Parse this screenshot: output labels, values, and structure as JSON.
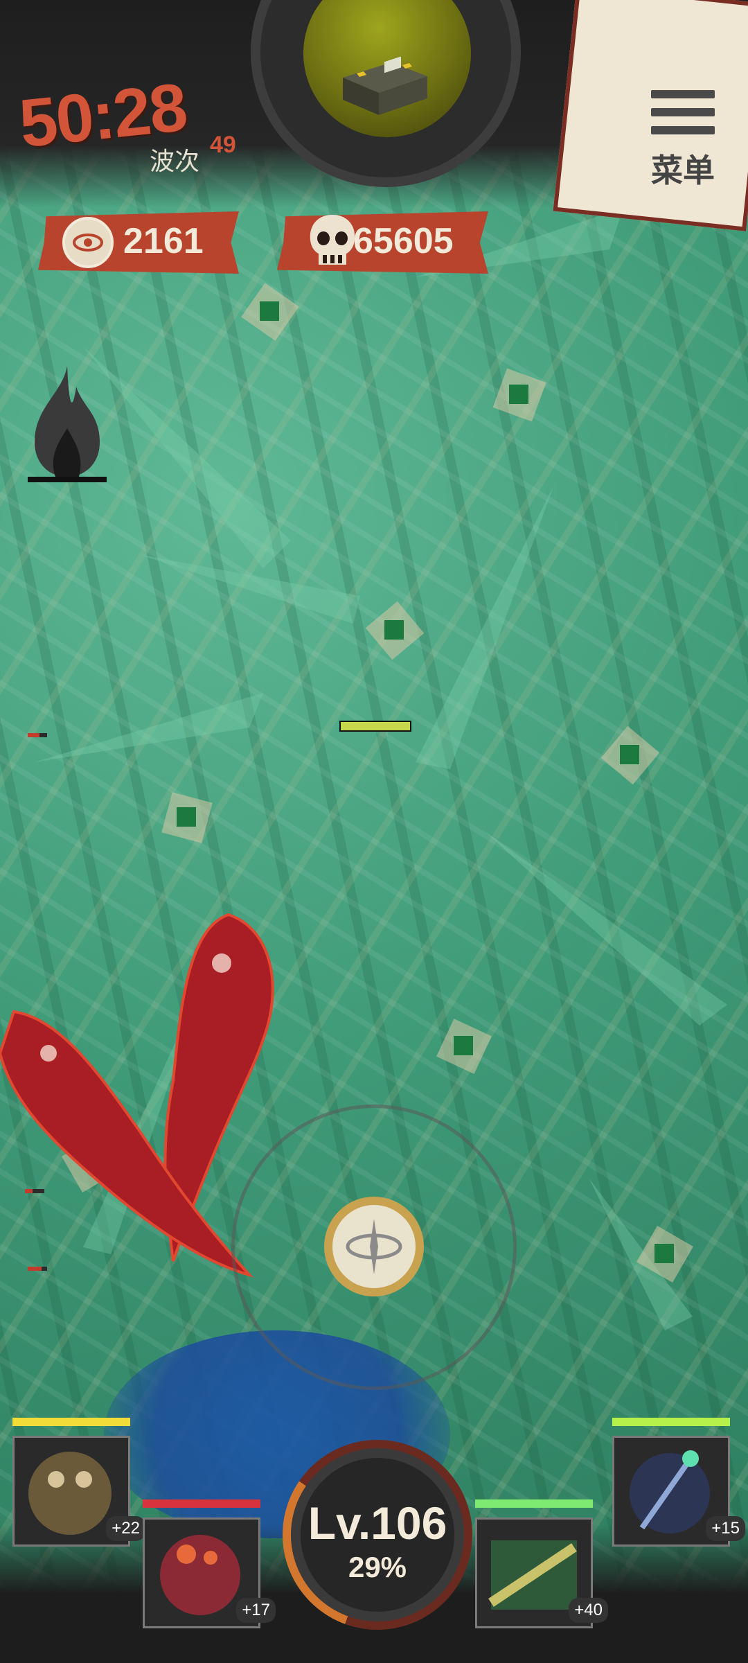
{
  "hud": {
    "timer": "50:28",
    "wave_label": "波次",
    "wave_number": "49",
    "menu_label": "菜单",
    "coins": "2161",
    "kills": "65605"
  },
  "player": {
    "level_text": "Lv.106",
    "xp_percent_text": "29%",
    "xp_progress": 0.29,
    "health_fraction": 1.0
  },
  "heroes": [
    {
      "slot": "top-left",
      "bonus": "+22",
      "bar_color": "#f2dc3a"
    },
    {
      "slot": "bottom-left",
      "bonus": "+17",
      "bar_color": "#d8323c"
    },
    {
      "slot": "bottom-right",
      "bonus": "+40",
      "bar_color": "#7eea72"
    },
    {
      "slot": "top-right",
      "bonus": "+15",
      "bar_color": "#b6f04a"
    }
  ],
  "colors": {
    "accent_red": "#b9442d",
    "timer_color": "#d2553a",
    "background_green": "#3f9a78",
    "joystick_ring": "#c9a24f"
  },
  "icons": [
    "chest-icon",
    "menu-icon",
    "coin-eye-icon",
    "skull-icon",
    "dark-flame-icon",
    "joystick-knob-icon"
  ]
}
